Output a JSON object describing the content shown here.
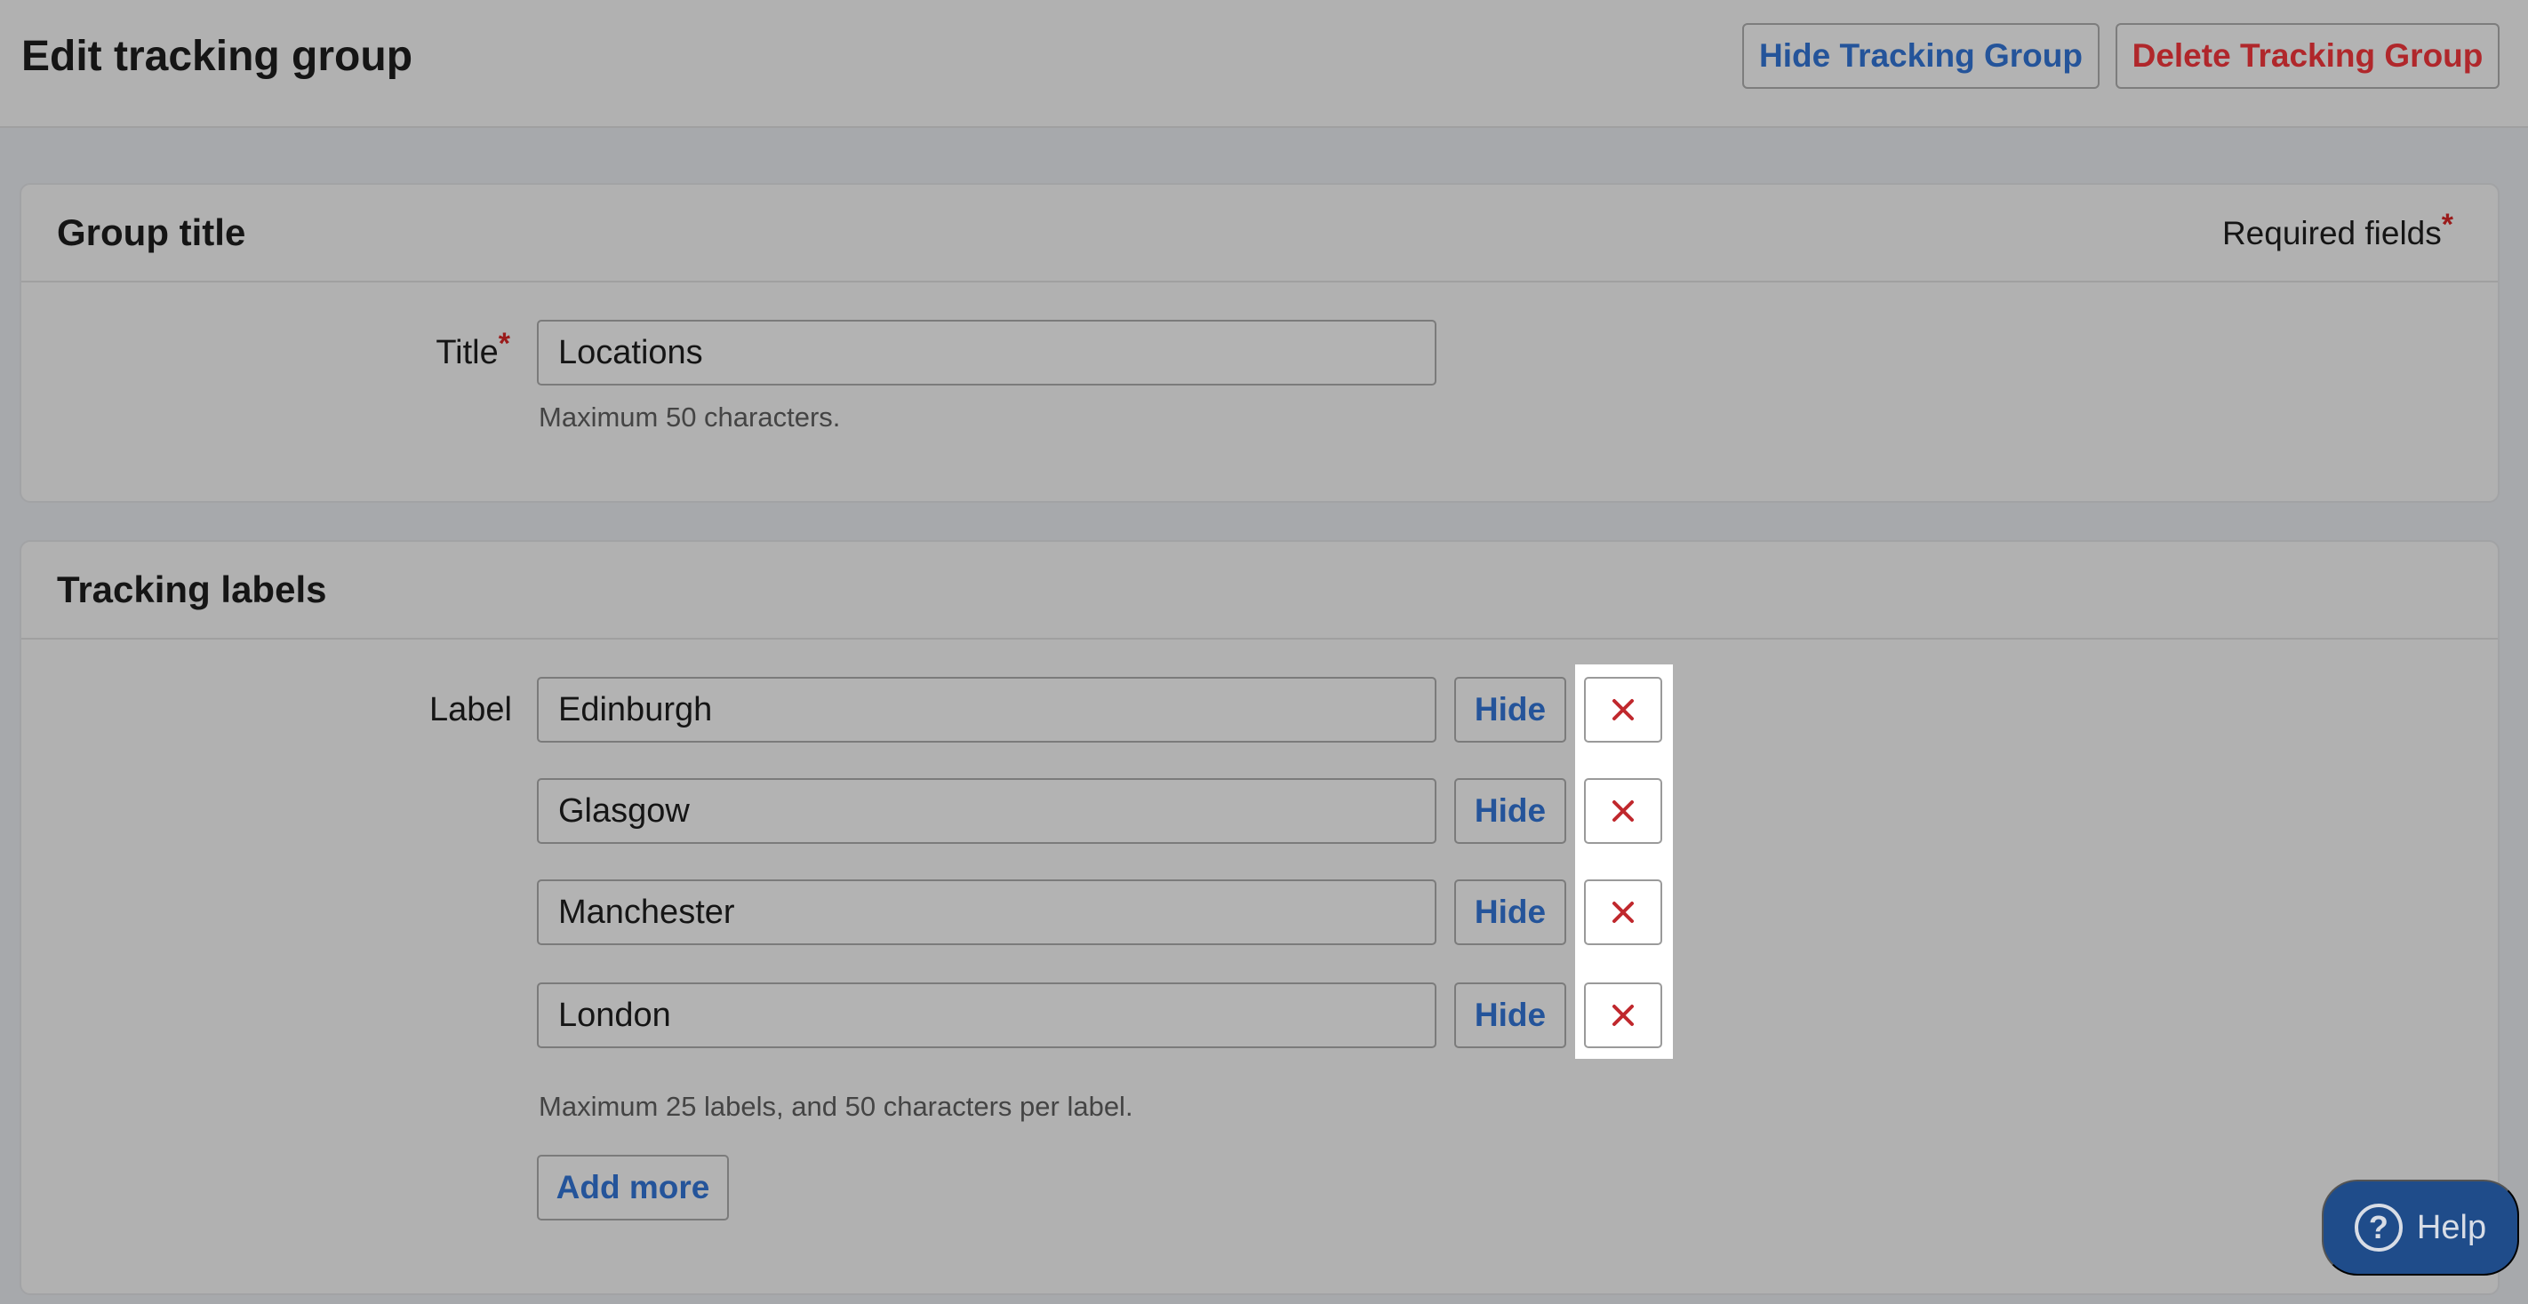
{
  "header": {
    "title": "Edit tracking group",
    "hide_group_label": "Hide Tracking Group",
    "delete_group_label": "Delete Tracking Group"
  },
  "group_title_panel": {
    "heading": "Group title",
    "required_note": "Required fields",
    "required_marker": "*",
    "title_field": {
      "label": "Title",
      "value": "Locations",
      "help": "Maximum 50 characters."
    }
  },
  "labels_panel": {
    "heading": "Tracking labels",
    "field_label": "Label",
    "labels": [
      {
        "value": "Edinburgh",
        "hide_label": "Hide"
      },
      {
        "value": "Glasgow",
        "hide_label": "Hide"
      },
      {
        "value": "Manchester",
        "hide_label": "Hide"
      },
      {
        "value": "London",
        "hide_label": "Hide"
      }
    ],
    "help": "Maximum 25 labels, and 50 characters per label.",
    "add_more_label": "Add more"
  },
  "help_widget": {
    "label": "Help",
    "glyph": "?"
  },
  "colors": {
    "link_blue": "#24549a",
    "danger_red": "#b0272b",
    "help_bg": "#1f4c8a"
  },
  "icons": {
    "remove": "close-x-icon",
    "help": "question-circle-icon"
  }
}
